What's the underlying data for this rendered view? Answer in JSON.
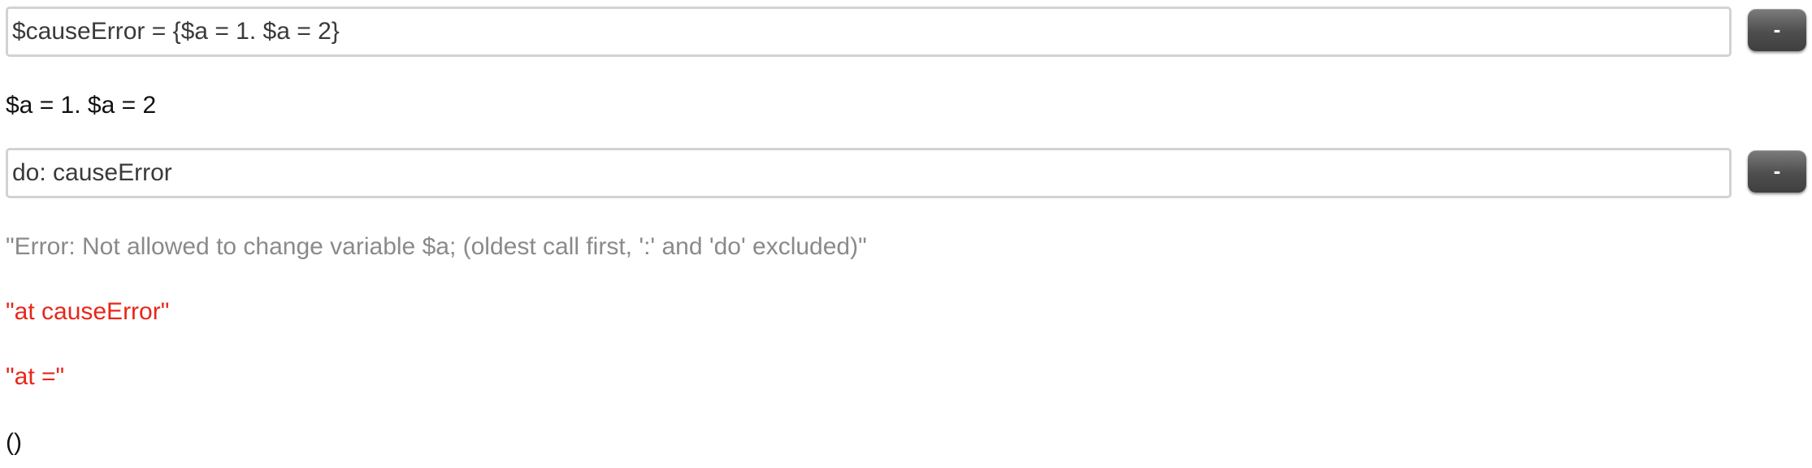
{
  "cells": [
    {
      "input": "$causeError = {$a = 1. $a = 2}",
      "button_label": "-"
    },
    {
      "input": "do: causeError",
      "button_label": "-"
    }
  ],
  "outputs": {
    "result1": "$a = 1. $a = 2",
    "error_message": "\"Error: Not allowed to change variable $a; (oldest call first, ':' and 'do' excluded)\"",
    "trace1": "\"at causeError\"",
    "trace2": "\"at =\"",
    "result2": "()"
  },
  "colors": {
    "input_text": "#3a3a3a",
    "error_gray": "#8a8a8a",
    "trace_red": "#e8261a",
    "button": "#4e4e4e"
  }
}
